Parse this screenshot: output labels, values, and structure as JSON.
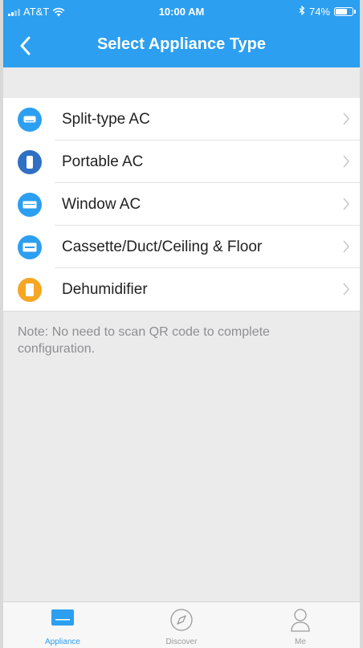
{
  "status_bar": {
    "carrier": "AT&T",
    "time": "10:00 AM",
    "battery_percent": "74%",
    "battery_level": 0.74,
    "icons": [
      "signal-icon",
      "wifi-icon",
      "bluetooth-icon",
      "battery-icon"
    ]
  },
  "nav": {
    "title": "Select Appliance Type",
    "back_icon": "chevron-left-icon"
  },
  "appliances": [
    {
      "label": "Split-type AC",
      "icon": "split-ac-icon",
      "color": "#2c9ff0"
    },
    {
      "label": "Portable AC",
      "icon": "portable-ac-icon",
      "color": "#2f6fc4"
    },
    {
      "label": "Window AC",
      "icon": "window-ac-icon",
      "color": "#2c9ff0"
    },
    {
      "label": "Cassette/Duct/Ceiling & Floor",
      "icon": "cassette-ac-icon",
      "color": "#2c9ff0"
    },
    {
      "label": "Dehumidifier",
      "icon": "dehumidifier-icon",
      "color": "#f5a623"
    }
  ],
  "note": "Note: No need to scan QR code to complete configuration.",
  "tabs": [
    {
      "label": "Appliance",
      "icon": "appliance-icon",
      "active": true
    },
    {
      "label": "Discover",
      "icon": "compass-icon",
      "active": false
    },
    {
      "label": "Me",
      "icon": "person-icon",
      "active": false
    }
  ],
  "colors": {
    "accent": "#2c9ff0",
    "background": "#ebebeb",
    "inactive_tab": "#9a9a9a"
  }
}
